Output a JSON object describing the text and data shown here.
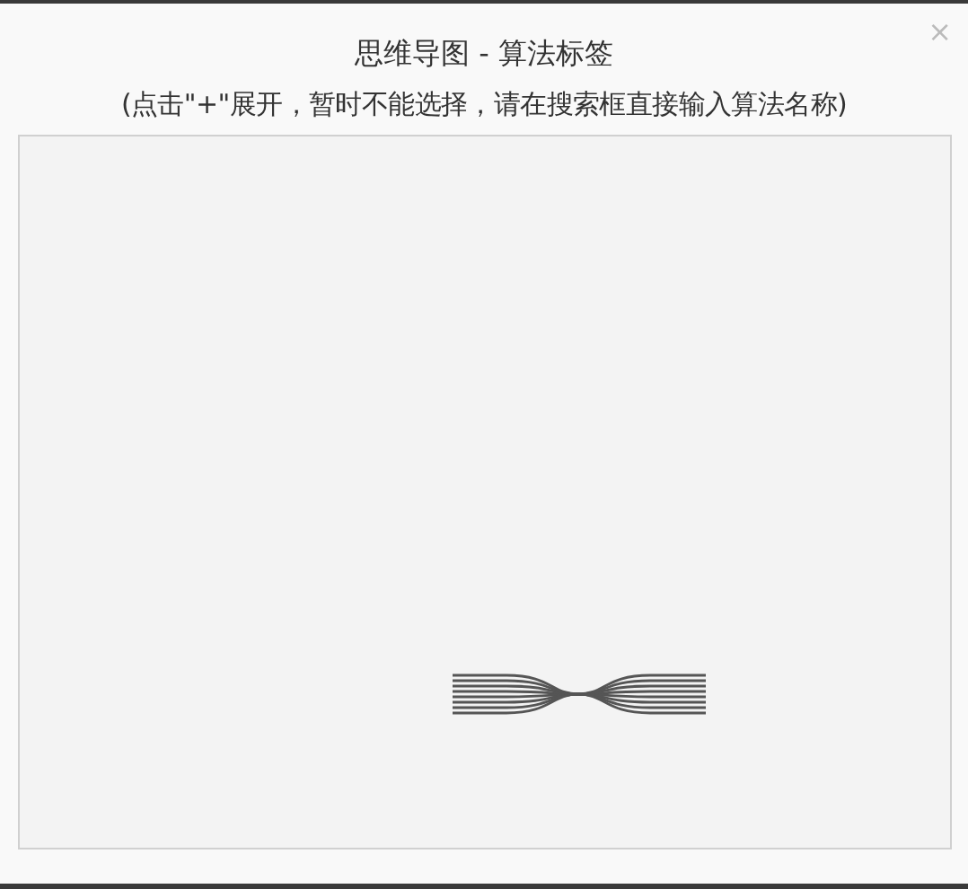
{
  "dialog": {
    "title": "思维导图 - 算法标签",
    "subtitle": "(点击\"+\"展开，暂时不能选择，请在搜索框直接输入算法名称)",
    "close": "×"
  }
}
